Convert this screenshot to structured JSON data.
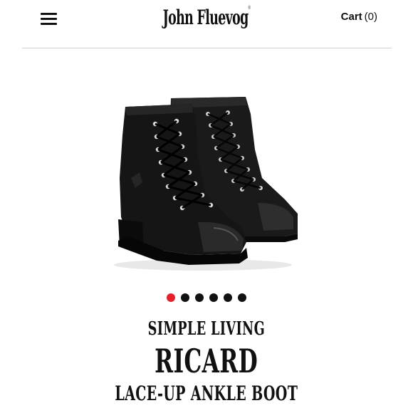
{
  "header": {
    "menu_icon": "hamburger-menu-icon",
    "logo": "John Fluevog",
    "logo_mark": "®",
    "cart_label": "Cart",
    "cart_count": "(0)"
  },
  "hero": {
    "image": "black lace-up ankle boots (pair)"
  },
  "carousel": {
    "slide_count": 6,
    "active_index": 0,
    "active_color": "#e3202b",
    "inactive_color": "#111111"
  },
  "product": {
    "collection": "SIMPLE LIVING",
    "name": "RICARD",
    "type": "LACE-UP ANKLE BOOT"
  }
}
